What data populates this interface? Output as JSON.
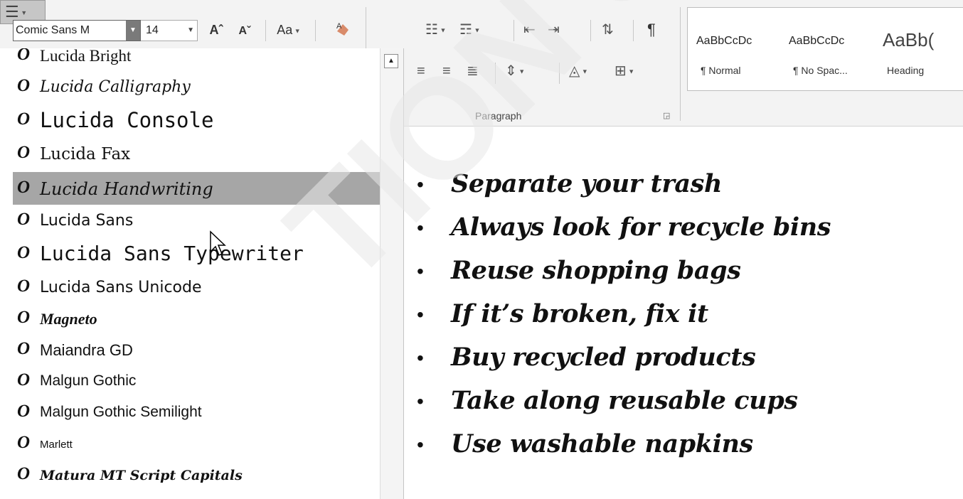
{
  "ribbon": {
    "font_name": "Comic Sans M",
    "font_size": "14",
    "grow_font": "Aˆ",
    "shrink_font": "Aˇ",
    "change_case": "Aa",
    "paragraph_label": "Paragraph",
    "styles": [
      {
        "preview": "AaBbCcDc",
        "name": "¶ Normal"
      },
      {
        "preview": "AaBbCcDc",
        "name": "¶ No Spac..."
      },
      {
        "preview": "AaBb(",
        "name": "Heading"
      }
    ]
  },
  "font_list": [
    {
      "name": "Lucida Bright",
      "selected": false
    },
    {
      "name": "Lucida Calligraphy",
      "selected": false
    },
    {
      "name": "Lucida Console",
      "selected": false
    },
    {
      "name": "Lucida Fax",
      "selected": false
    },
    {
      "name": "Lucida Handwriting",
      "selected": true
    },
    {
      "name": "Lucida Sans",
      "selected": false
    },
    {
      "name": "Lucida Sans Typewriter",
      "selected": false
    },
    {
      "name": "Lucida Sans Unicode",
      "selected": false
    },
    {
      "name": "Magneto",
      "selected": false
    },
    {
      "name": "Maiandra GD",
      "selected": false
    },
    {
      "name": "Malgun Gothic",
      "selected": false
    },
    {
      "name": "Malgun Gothic Semilight",
      "selected": false
    },
    {
      "name": "Marlett",
      "selected": false
    },
    {
      "name": "Matura MT Script Capitals",
      "selected": false
    }
  ],
  "font_type_glyph": "O",
  "document": {
    "bullet_char": "•",
    "items": [
      "Separate your trash",
      "Always look for recycle bins",
      "Reuse shopping bags",
      "If it’s broken, fix it",
      "Buy recycled products",
      "Take along reusable cups",
      "Use washable napkins"
    ]
  },
  "watermark": "TION ONL",
  "colors": {
    "selection": "#a6a6a6",
    "ribbon_bg": "#f3f3f3",
    "text": "#111111"
  }
}
